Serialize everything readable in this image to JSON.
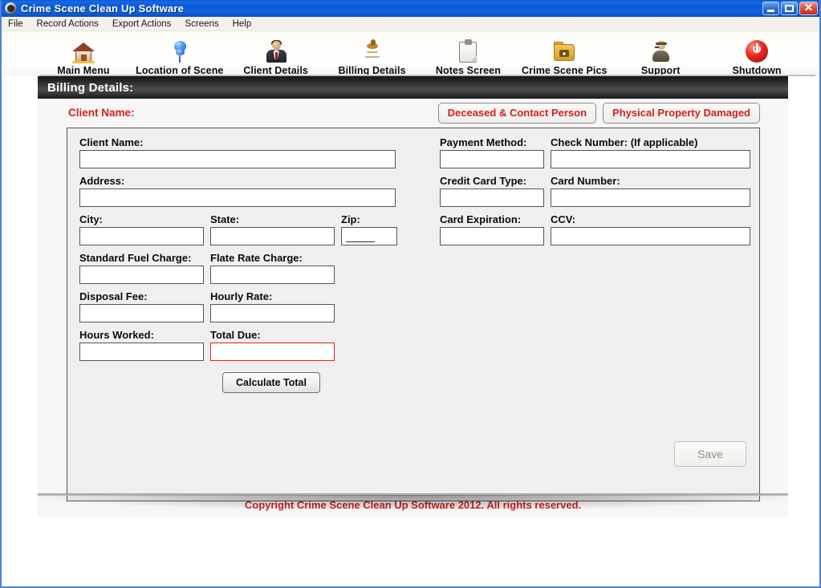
{
  "window": {
    "title": "Crime Scene Clean Up Software",
    "app_icon": "app-icon",
    "controls": {
      "minimize": "minimize-icon",
      "maximize": "maximize-icon",
      "close": "close-icon"
    }
  },
  "menubar": {
    "items": [
      {
        "label": "File"
      },
      {
        "label": "Record Actions"
      },
      {
        "label": "Export Actions"
      },
      {
        "label": "Screens"
      },
      {
        "label": "Help"
      }
    ]
  },
  "toolbar": {
    "items": [
      {
        "label": "Main Menu",
        "icon": "home-icon"
      },
      {
        "label": "Location of Scene",
        "icon": "map-pin-icon"
      },
      {
        "label": "Client Details",
        "icon": "person-suit-icon"
      },
      {
        "label": "Billing Details",
        "icon": "money-bag-icon"
      },
      {
        "label": "Notes Screen",
        "icon": "clipboard-icon"
      },
      {
        "label": "Crime Scene Pics",
        "icon": "folder-camera-icon"
      },
      {
        "label": "Support",
        "icon": "headset-person-icon"
      },
      {
        "label": "Shutdown",
        "icon": "power-icon"
      }
    ]
  },
  "section": {
    "title": "Billing Details:"
  },
  "toprow": {
    "client_name_heading": "Client Name:",
    "buttons": [
      {
        "label": "Deceased & Contact Person"
      },
      {
        "label": "Physical Property Damaged"
      }
    ]
  },
  "form": {
    "left": {
      "client_name": {
        "label": "Client Name:",
        "value": "",
        "placeholder": ""
      },
      "address": {
        "label": "Address:",
        "value": "",
        "placeholder": ""
      },
      "city": {
        "label": "City:",
        "value": "",
        "placeholder": ""
      },
      "state": {
        "label": "State:",
        "value": "",
        "placeholder": ""
      },
      "zip": {
        "label": "Zip:",
        "value": "",
        "placeholder": ""
      },
      "standard_fuel_charge": {
        "label": "Standard Fuel Charge:",
        "value": "",
        "placeholder": ""
      },
      "flate_rate_charge": {
        "label": "Flate Rate Charge:",
        "value": "",
        "placeholder": ""
      },
      "disposal_fee": {
        "label": "Disposal Fee:",
        "value": "",
        "placeholder": ""
      },
      "hourly_rate": {
        "label": "Hourly Rate:",
        "value": "",
        "placeholder": ""
      },
      "hours_worked": {
        "label": "Hours Worked:",
        "value": "",
        "placeholder": ""
      },
      "total_due": {
        "label": "Total Due:",
        "value": "",
        "placeholder": ""
      },
      "calculate_button": "Calculate Total"
    },
    "right": {
      "payment_method": {
        "label": "Payment Method:",
        "value": "",
        "placeholder": ""
      },
      "check_number": {
        "label": "Check Number: (If applicable)",
        "value": "",
        "placeholder": ""
      },
      "credit_card_type": {
        "label": "Credit Card Type:",
        "value": "",
        "placeholder": ""
      },
      "card_number": {
        "label": "Card Number:",
        "value": "",
        "placeholder": ""
      },
      "card_expiration": {
        "label": "Card Expiration:",
        "value": "",
        "placeholder": ""
      },
      "ccv": {
        "label": "CCV:",
        "value": "",
        "placeholder": ""
      }
    },
    "save_button": "Save"
  },
  "footer": {
    "copyright": "Copyright Crime Scene Clean Up Software 2012. All rights reserved."
  },
  "colors": {
    "titlebar_blue": "#0f63e0",
    "accent_red": "#cc2222",
    "total_due_border": "#e02020",
    "header_black": "#1a1a1a",
    "panel_gray": "#f0eeee"
  }
}
